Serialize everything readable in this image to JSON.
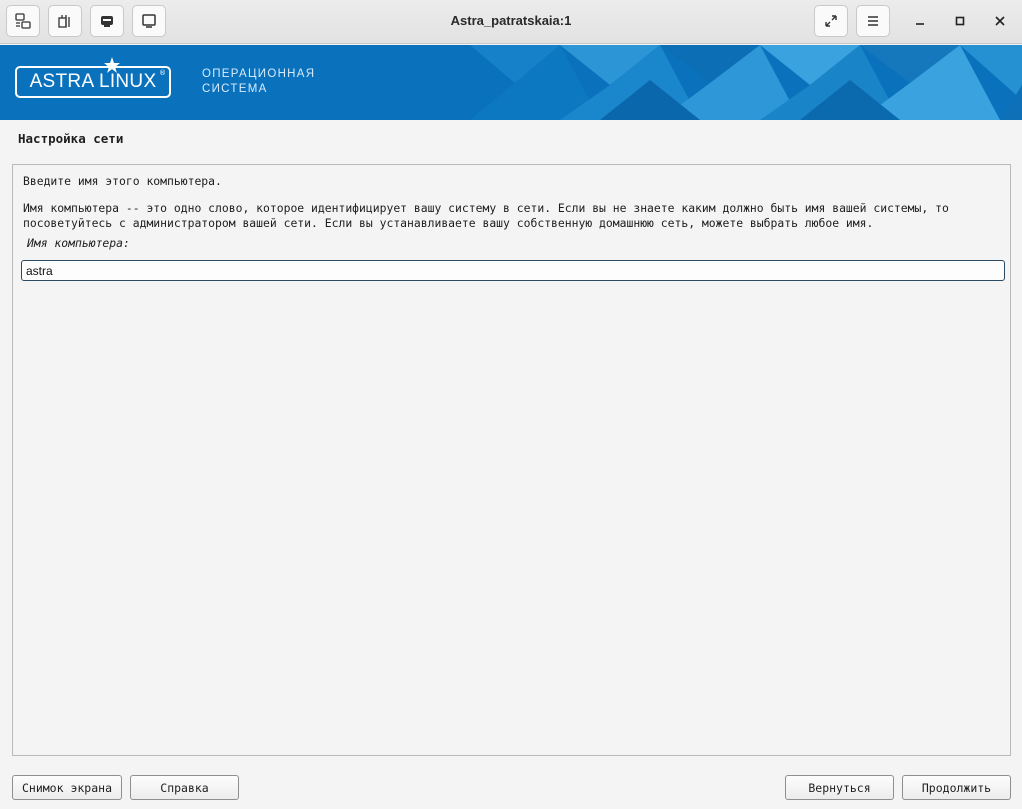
{
  "window": {
    "title": "Astra_patratskaia:1",
    "toolbar_icons": [
      "windows-icon",
      "send-keys-icon",
      "usb-icon",
      "display-icon"
    ],
    "right_icons": [
      "fullscreen-icon",
      "menu-icon"
    ],
    "controls": {
      "minimize": "–",
      "maximize": "□",
      "close": "✕"
    }
  },
  "banner": {
    "logo_text": "ASTRA LINUX",
    "logo_reg": "®",
    "caption_line1": "ОПЕРАЦИОННАЯ",
    "caption_line2": "СИСТЕМА",
    "background_color": "#0a72bd"
  },
  "installer": {
    "section_title": "Настройка сети",
    "prompt": "Введите имя этого компьютера.",
    "description": "Имя компьютера -- это одно слово, которое идентифицирует вашу систему в сети. Если вы не знаете каким должно быть имя вашей системы, то посоветуйтесь с администратором вашей сети. Если вы устанавливаете вашу собственную домашнюю сеть, можете выбрать любое имя.",
    "field_label": "Имя компьютера:",
    "hostname_value": "astra"
  },
  "buttons": {
    "screenshot": "Снимок экрана",
    "help": "Справка",
    "back": "Вернуться",
    "continue": "Продолжить"
  }
}
